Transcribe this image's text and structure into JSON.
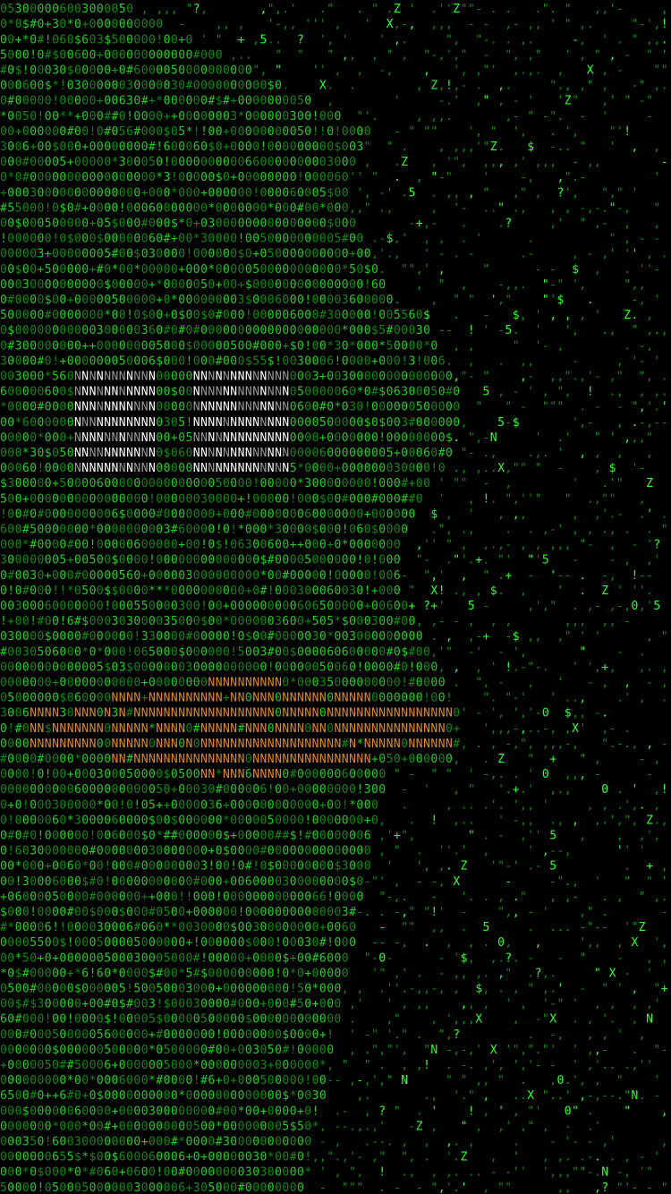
{
  "artwork": {
    "kind": "ascii-art",
    "description_visible": false,
    "palette": {
      "background": "#000000",
      "green_bright": "#2cff2c",
      "green_mid": "#1fd01f",
      "green_dim": "#0f8a0f",
      "white": "#ffffff",
      "grey": "#9a9a9a",
      "orange": "#e08a1e"
    },
    "glyph_sets": {
      "dense": "000000000000000000",
      "medium": "0*$5!36#+",
      "sparse": ",',.\"-",
      "rain": "N,?.\"$'5,0!+-XZ,",
      "eyes": "NNNNNNN"
    }
  }
}
